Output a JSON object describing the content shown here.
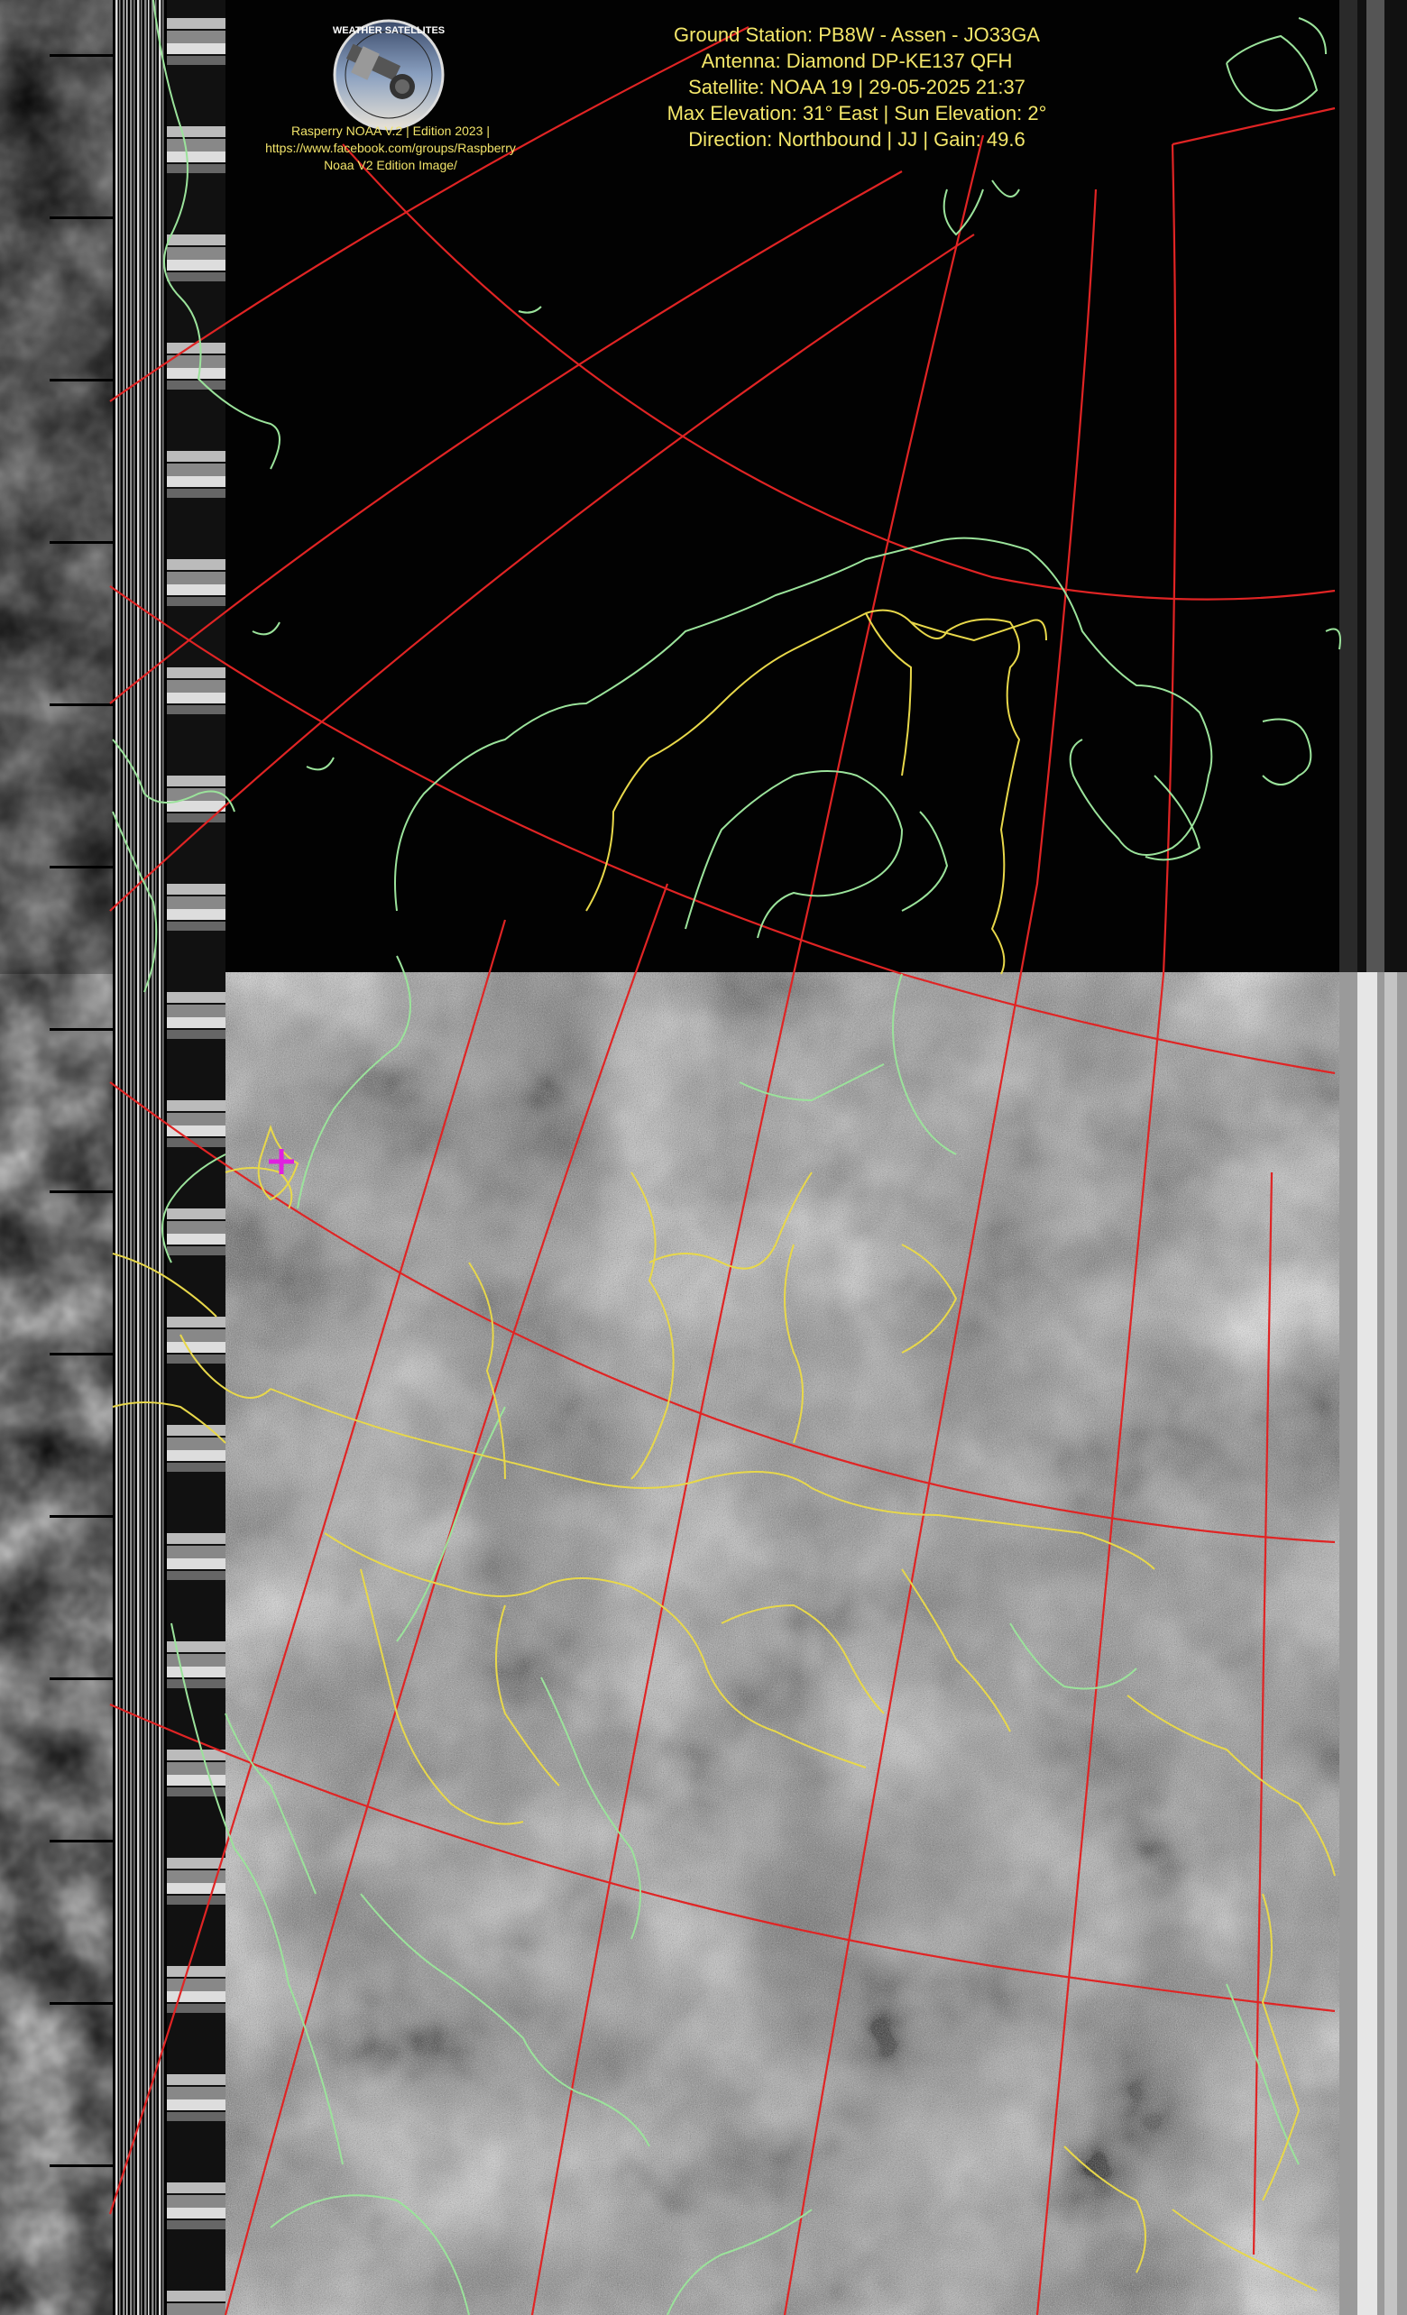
{
  "image": {
    "description_colors": {
      "coastline": "#9be39b",
      "border": "#e8d84a",
      "grid": "#e02424",
      "marker": "#e020e0",
      "text": "#f4e76a"
    }
  },
  "logo": {
    "ring_text": "WEATHER SATELLITES",
    "lines": [
      "Rasperry NOAA V.2 | Edition 2023 |",
      "https://www.facebook.com/groups/Raspberry",
      "Noaa V2 Edition Image/"
    ]
  },
  "info": {
    "station": "Ground Station: PB8W - Assen - JO33GA",
    "antenna": "Antenna: Diamond DP-KE137 QFH",
    "satellite": "Satellite: NOAA 19 | 29-05-2025 21:37",
    "elevation": "Max Elevation: 31° East | Sun Elevation: 2°",
    "direction": "Direction: Northbound | JJ | Gain: 49.6"
  }
}
